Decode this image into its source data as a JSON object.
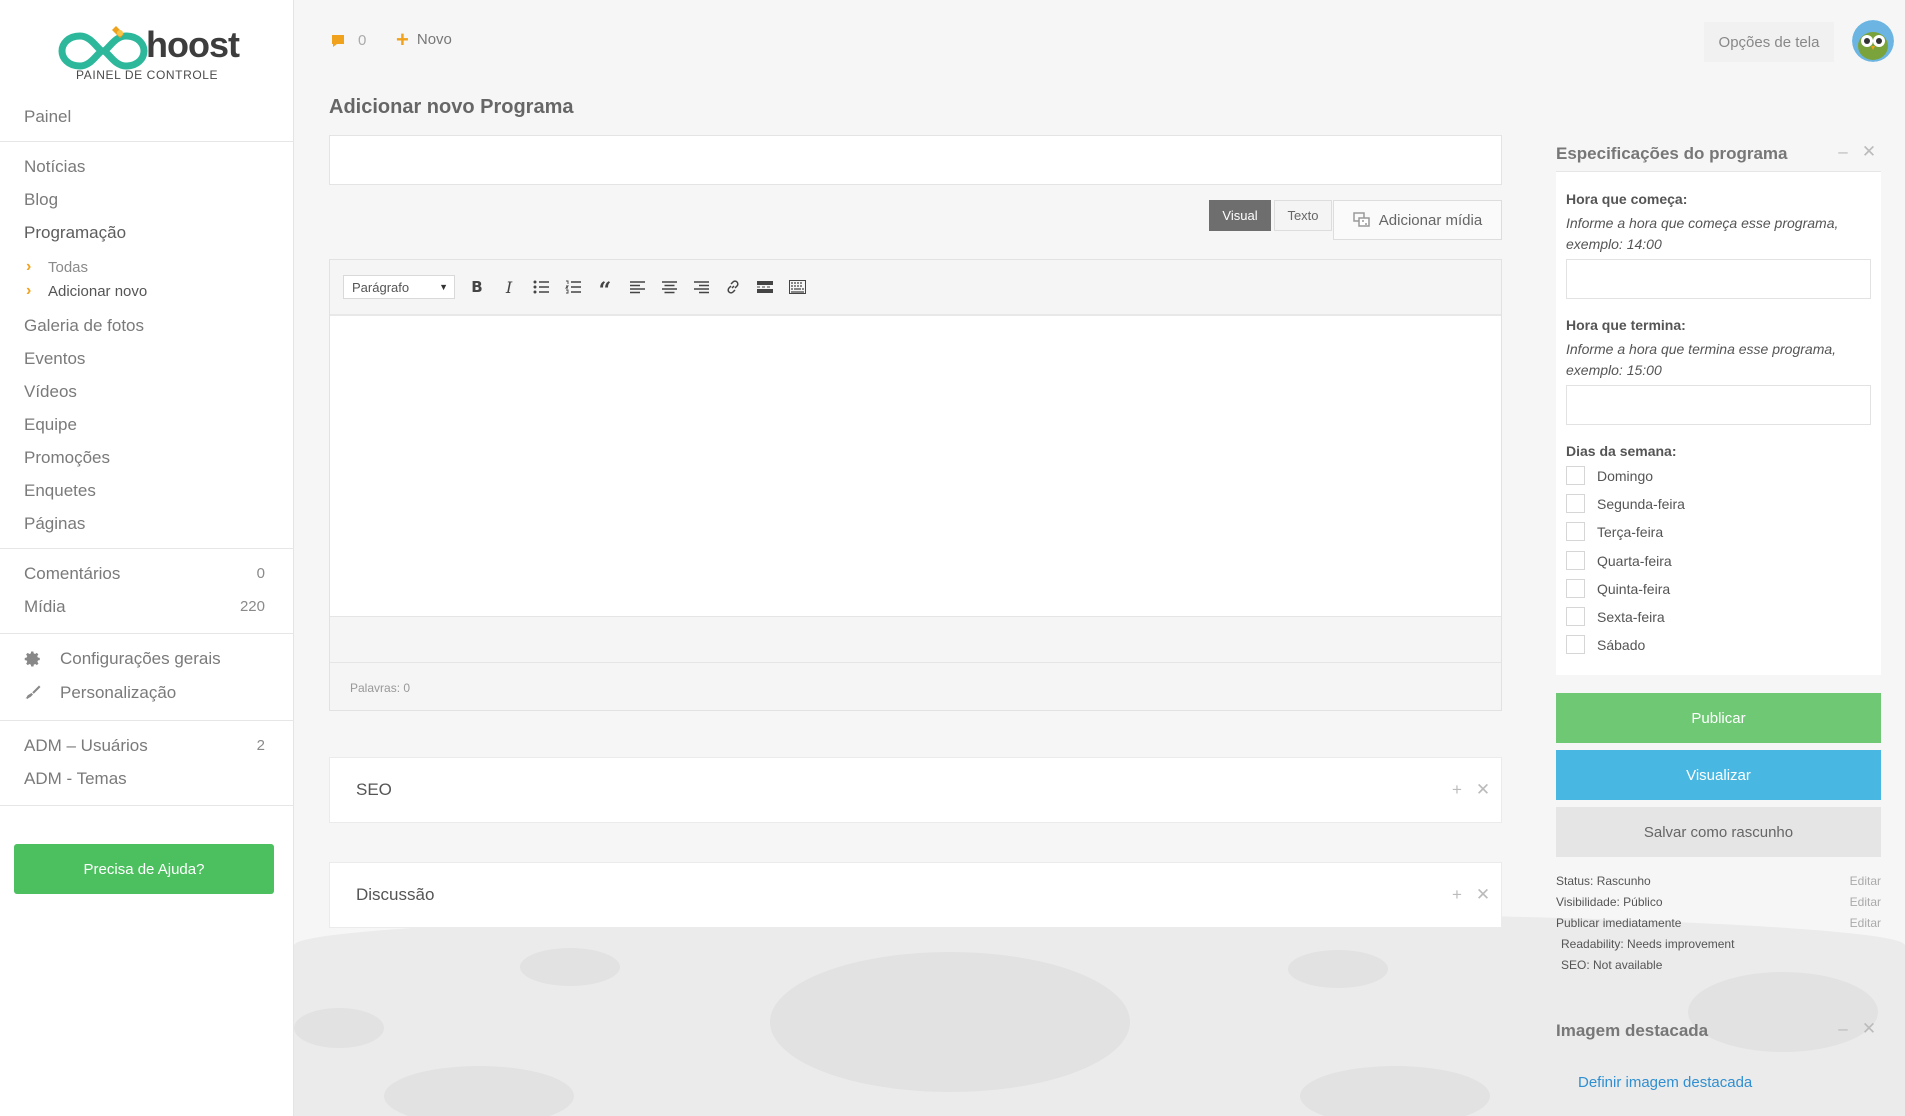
{
  "app": {
    "logo_text": "hoost",
    "logo_subtitle": "PAINEL DE CONTROLE"
  },
  "sidebar": {
    "groups": [
      {
        "items": [
          {
            "label": "Painel"
          }
        ]
      },
      {
        "items": [
          {
            "label": "Notícias"
          },
          {
            "label": "Blog"
          },
          {
            "label": "Programação",
            "active": true
          }
        ],
        "subitems": [
          {
            "label": "Todas"
          },
          {
            "label": "Adicionar novo",
            "active": true
          }
        ],
        "more": [
          {
            "label": "Galeria de fotos"
          },
          {
            "label": "Eventos"
          },
          {
            "label": "Vídeos"
          },
          {
            "label": "Equipe"
          },
          {
            "label": "Promoções"
          },
          {
            "label": "Enquetes"
          },
          {
            "label": "Páginas"
          }
        ]
      },
      {
        "items": [
          {
            "label": "Comentários",
            "count": "0"
          },
          {
            "label": "Mídia",
            "count": "220"
          }
        ]
      },
      {
        "items": [
          {
            "label": "Configurações gerais",
            "icon": "gear-icon"
          },
          {
            "label": "Personalização",
            "icon": "brush-icon"
          }
        ]
      },
      {
        "items": [
          {
            "label": "ADM – Usuários",
            "count": "2"
          },
          {
            "label": "ADM - Temas"
          }
        ]
      }
    ],
    "help_button": "Precisa de Ajuda?"
  },
  "topbar": {
    "comments_count": "0",
    "new_label": "Novo",
    "screen_options": "Opções de tela"
  },
  "main": {
    "page_title": "Adicionar novo Programa",
    "editor": {
      "mode_visual": "Visual",
      "mode_text": "Texto",
      "add_media": "Adicionar mídia",
      "format_select": "Parágrafo",
      "word_count": "Palavras: 0"
    },
    "metaboxes": [
      {
        "title": "SEO"
      },
      {
        "title": "Discussão"
      }
    ]
  },
  "right_panel": {
    "specs_title": "Especificações do programa",
    "start_label": "Hora que começa:",
    "start_help": "Informe a hora que começa esse programa, exemplo: 14:00",
    "end_label": "Hora que termina:",
    "end_help": "Informe a hora que termina esse programa, exemplo: 15:00",
    "days_label": "Dias da semana:",
    "days": [
      "Domingo",
      "Segunda-feira",
      "Terça-feira",
      "Quarta-feira",
      "Quinta-feira",
      "Sexta-feira",
      "Sábado"
    ],
    "publish": "Publicar",
    "preview": "Visualizar",
    "save_draft": "Salvar como rascunho",
    "status": [
      {
        "label": "Status: Rascunho",
        "edit": "Editar"
      },
      {
        "label": "Visibilidade: Público",
        "edit": "Editar"
      },
      {
        "label": "Publicar imediatamente",
        "edit": "Editar"
      }
    ],
    "readability": "Readability: Needs improvement",
    "seo": "SEO: Not available",
    "featured_title": "Imagem destacada",
    "featured_link": "Definir imagem destacada"
  },
  "colors": {
    "accent_orange": "#f0a21d",
    "publish_green": "#6fc874",
    "preview_blue": "#48b7e2",
    "help_green": "#4cbf5f",
    "link_blue": "#2f8fd1"
  }
}
